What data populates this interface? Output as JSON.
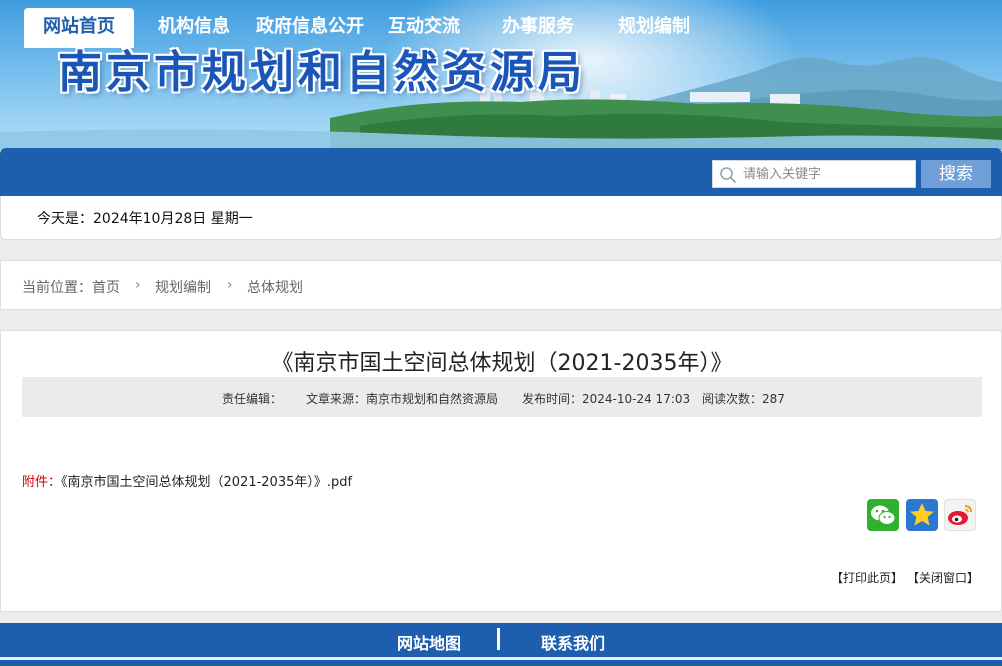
{
  "site": {
    "title": "南京市规划和自然资源局"
  },
  "nav": {
    "items": [
      {
        "label": "网站首页",
        "active": true
      },
      {
        "label": "机构信息"
      },
      {
        "label": "政府信息公开"
      },
      {
        "label": "互动交流"
      },
      {
        "label": "办事服务"
      },
      {
        "label": "规划编制"
      }
    ],
    "search": {
      "placeholder": "请输入关键字",
      "button_label": "搜索"
    }
  },
  "date": {
    "text": "今天是：2024年10月28日  星期一"
  },
  "breadcrumb": {
    "prefix": "当前位置：",
    "items": [
      "首页",
      "规划编制",
      "总体规划"
    ],
    "separator": "›"
  },
  "article": {
    "title": "《南京市国土空间总体规划（2021-2035年）》",
    "meta": {
      "editor": "责任编辑：",
      "source": "文章来源：南京市规划和自然资源局",
      "published": "发布时间：2024-10-24 17:03",
      "views": "阅读次数：287"
    },
    "attachment": {
      "label": "附件：",
      "file": "《南京市国土空间总体规划（2021-2035年）》.pdf"
    },
    "share": [
      "wechat-icon",
      "qzone-icon",
      "weibo-icon"
    ],
    "tools": {
      "print": "【打印此页】",
      "close": "【关闭窗口】"
    }
  },
  "footer": {
    "links": [
      "网站地图",
      "联系我们"
    ]
  },
  "colors": {
    "nav_blue": "#1d5fae",
    "attach_red": "#cc0000"
  }
}
